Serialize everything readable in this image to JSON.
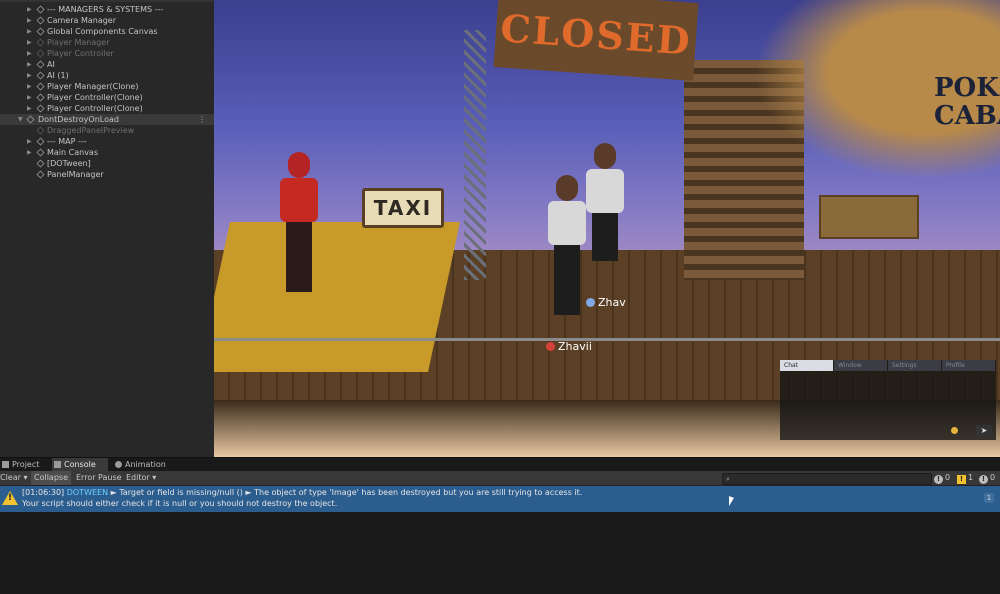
{
  "hierarchy": {
    "items": [
      {
        "label": "--- MANAGERS & SYSTEMS ---",
        "dim": false
      },
      {
        "label": "Camera Manager",
        "dim": false
      },
      {
        "label": "Global Components Canvas",
        "dim": false
      },
      {
        "label": "Player Manager",
        "dim": true
      },
      {
        "label": "Player Controller",
        "dim": true
      },
      {
        "label": "AI",
        "dim": false
      },
      {
        "label": "AI (1)",
        "dim": false
      },
      {
        "label": "Player Manager(Clone)",
        "dim": false
      },
      {
        "label": "Player Controller(Clone)",
        "dim": false
      },
      {
        "label": "Player Controller(Clone)",
        "dim": false
      }
    ],
    "dontdestroy_label": "DontDestroyOnLoad",
    "children": [
      {
        "label": "DraggedPanelPreview",
        "dim": true
      },
      {
        "label": "--- MAP ---",
        "dim": false
      },
      {
        "label": "Main Canvas",
        "dim": false
      },
      {
        "label": "[DOTween]",
        "dim": false
      },
      {
        "label": "PanelManager",
        "dim": false
      }
    ]
  },
  "scene": {
    "sign_closed": "CLOSED",
    "sign_taxi": "TAXI",
    "logo": "POKER CABANA",
    "players": [
      {
        "name": "Zhav",
        "badge_color": "#7fa8e6"
      },
      {
        "name": "Zhavii",
        "badge_color": "#d8413a"
      }
    ],
    "chat_tabs": [
      "Chat",
      "Window",
      "Settings",
      "Profile"
    ]
  },
  "tabs": {
    "project": "Project",
    "console": "Console",
    "animation": "Animation"
  },
  "toolbar": {
    "clear": "Clear",
    "collapse": "Collapse",
    "error_pause": "Error Pause",
    "editor": "Editor",
    "log_count": "0",
    "warn_count": "1",
    "error_count": "0"
  },
  "log": {
    "timestamp": "[01:06:30]",
    "tag": "DOTWEEN",
    "line1": "► Target or field is missing/null () ► The object of type 'Image' has been destroyed but you are still trying to access it.",
    "line2": "Your script should either check if it is null or you should not destroy the object.",
    "count": "1"
  },
  "colors": {
    "log_highlight": "#2c5d8f",
    "warning": "#f2c230",
    "dotween_tag": "#6dd0ff"
  }
}
